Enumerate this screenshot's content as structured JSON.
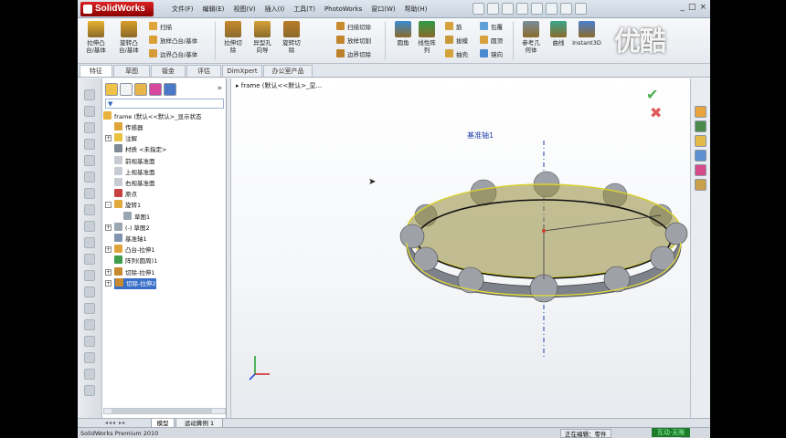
{
  "app": {
    "logo": "SolidWorks",
    "menu": [
      "文件(F)",
      "编辑(E)",
      "视图(V)",
      "插入(I)",
      "工具(T)",
      "PhotoWorks",
      "窗口(W)",
      "帮助(H)"
    ],
    "window_controls": [
      "_",
      "□",
      "×"
    ]
  },
  "ribbon": {
    "big": [
      {
        "label": "拉伸凸\n台/基体",
        "color": "#e8b130"
      },
      {
        "label": "旋转凸\n台/基体",
        "color": "#d99d2b"
      },
      {
        "label": "拉伸切\n除",
        "color": "#c78a2e"
      },
      {
        "label": "异型孔\n向导",
        "color": "#d6a13a"
      },
      {
        "label": "旋转切\n除",
        "color": "#b97d2a"
      },
      {
        "label": "圆角",
        "color": "#3a8bd2"
      },
      {
        "label": "线性阵\n列",
        "color": "#2f9a45"
      },
      {
        "label": "参考几\n何体",
        "color": "#7a8d9c"
      },
      {
        "label": "曲线",
        "color": "#3aa58c"
      },
      {
        "label": "Instant3D",
        "color": "#4a7fd0"
      }
    ],
    "small": {
      "sweep": "扫描",
      "loft": "放样凸台/基体",
      "boundary": "边界凸台/基体",
      "sweep_cut": "扫描切除",
      "loft_cut": "放样切割",
      "boundary_cut": "边界切除",
      "rib": "筋",
      "draft": "拔模",
      "shell": "抽壳",
      "wrap": "包覆",
      "dome": "圆顶",
      "mirror": "镜向"
    }
  },
  "tabs": [
    "特征",
    "草图",
    "钣金",
    "评估",
    "DimXpert",
    "办公室产品"
  ],
  "tree": {
    "root": "frame  (默认<<默认>_显示状态",
    "nodes": [
      {
        "label": "传感器",
        "color": "#e0a53a",
        "exp": "",
        "indent": 1
      },
      {
        "label": "注解",
        "color": "#e8c340",
        "exp": "+",
        "indent": 1
      },
      {
        "label": "材质 <未指定>",
        "color": "#7f8a96",
        "exp": "",
        "indent": 1
      },
      {
        "label": "前视基准面",
        "color": "#c7cbd2",
        "exp": "",
        "indent": 1
      },
      {
        "label": "上视基准面",
        "color": "#c7cbd2",
        "exp": "",
        "indent": 1
      },
      {
        "label": "右视基准面",
        "color": "#c7cbd2",
        "exp": "",
        "indent": 1
      },
      {
        "label": "原点",
        "color": "#c94040",
        "exp": "",
        "indent": 1
      },
      {
        "label": "旋转1",
        "color": "#e2a93c",
        "exp": "-",
        "indent": 1
      },
      {
        "label": "草图1",
        "color": "#9aa5b2",
        "exp": "",
        "indent": 2
      },
      {
        "label": "(-) 草图2",
        "color": "#9aa5b2",
        "exp": "+",
        "indent": 1
      },
      {
        "label": "基准轴1",
        "color": "#8093b0",
        "exp": "",
        "indent": 1
      },
      {
        "label": "凸台-拉伸1",
        "color": "#e0a53a",
        "exp": "+",
        "indent": 1
      },
      {
        "label": "阵列(圆周)1",
        "color": "#3f9c4a",
        "exp": "",
        "indent": 1
      },
      {
        "label": "切除-拉伸1",
        "color": "#c98a2f",
        "exp": "+",
        "indent": 1
      },
      {
        "label": "切除-拉伸2",
        "color": "#c98a2f",
        "exp": "+",
        "indent": 1,
        "selected": true
      }
    ]
  },
  "viewport": {
    "breadcrumb": "frame  (默认<<默认>_显...",
    "axis_label": "基准轴1"
  },
  "bottom_tabs": [
    "模型",
    "运动算例 1"
  ],
  "status": {
    "left": "SolidWorks Premium 2010",
    "right": "正在编辑：零件",
    "help": "?"
  },
  "watermark": {
    "top": "优酷",
    "bottom": "互动·无限"
  }
}
